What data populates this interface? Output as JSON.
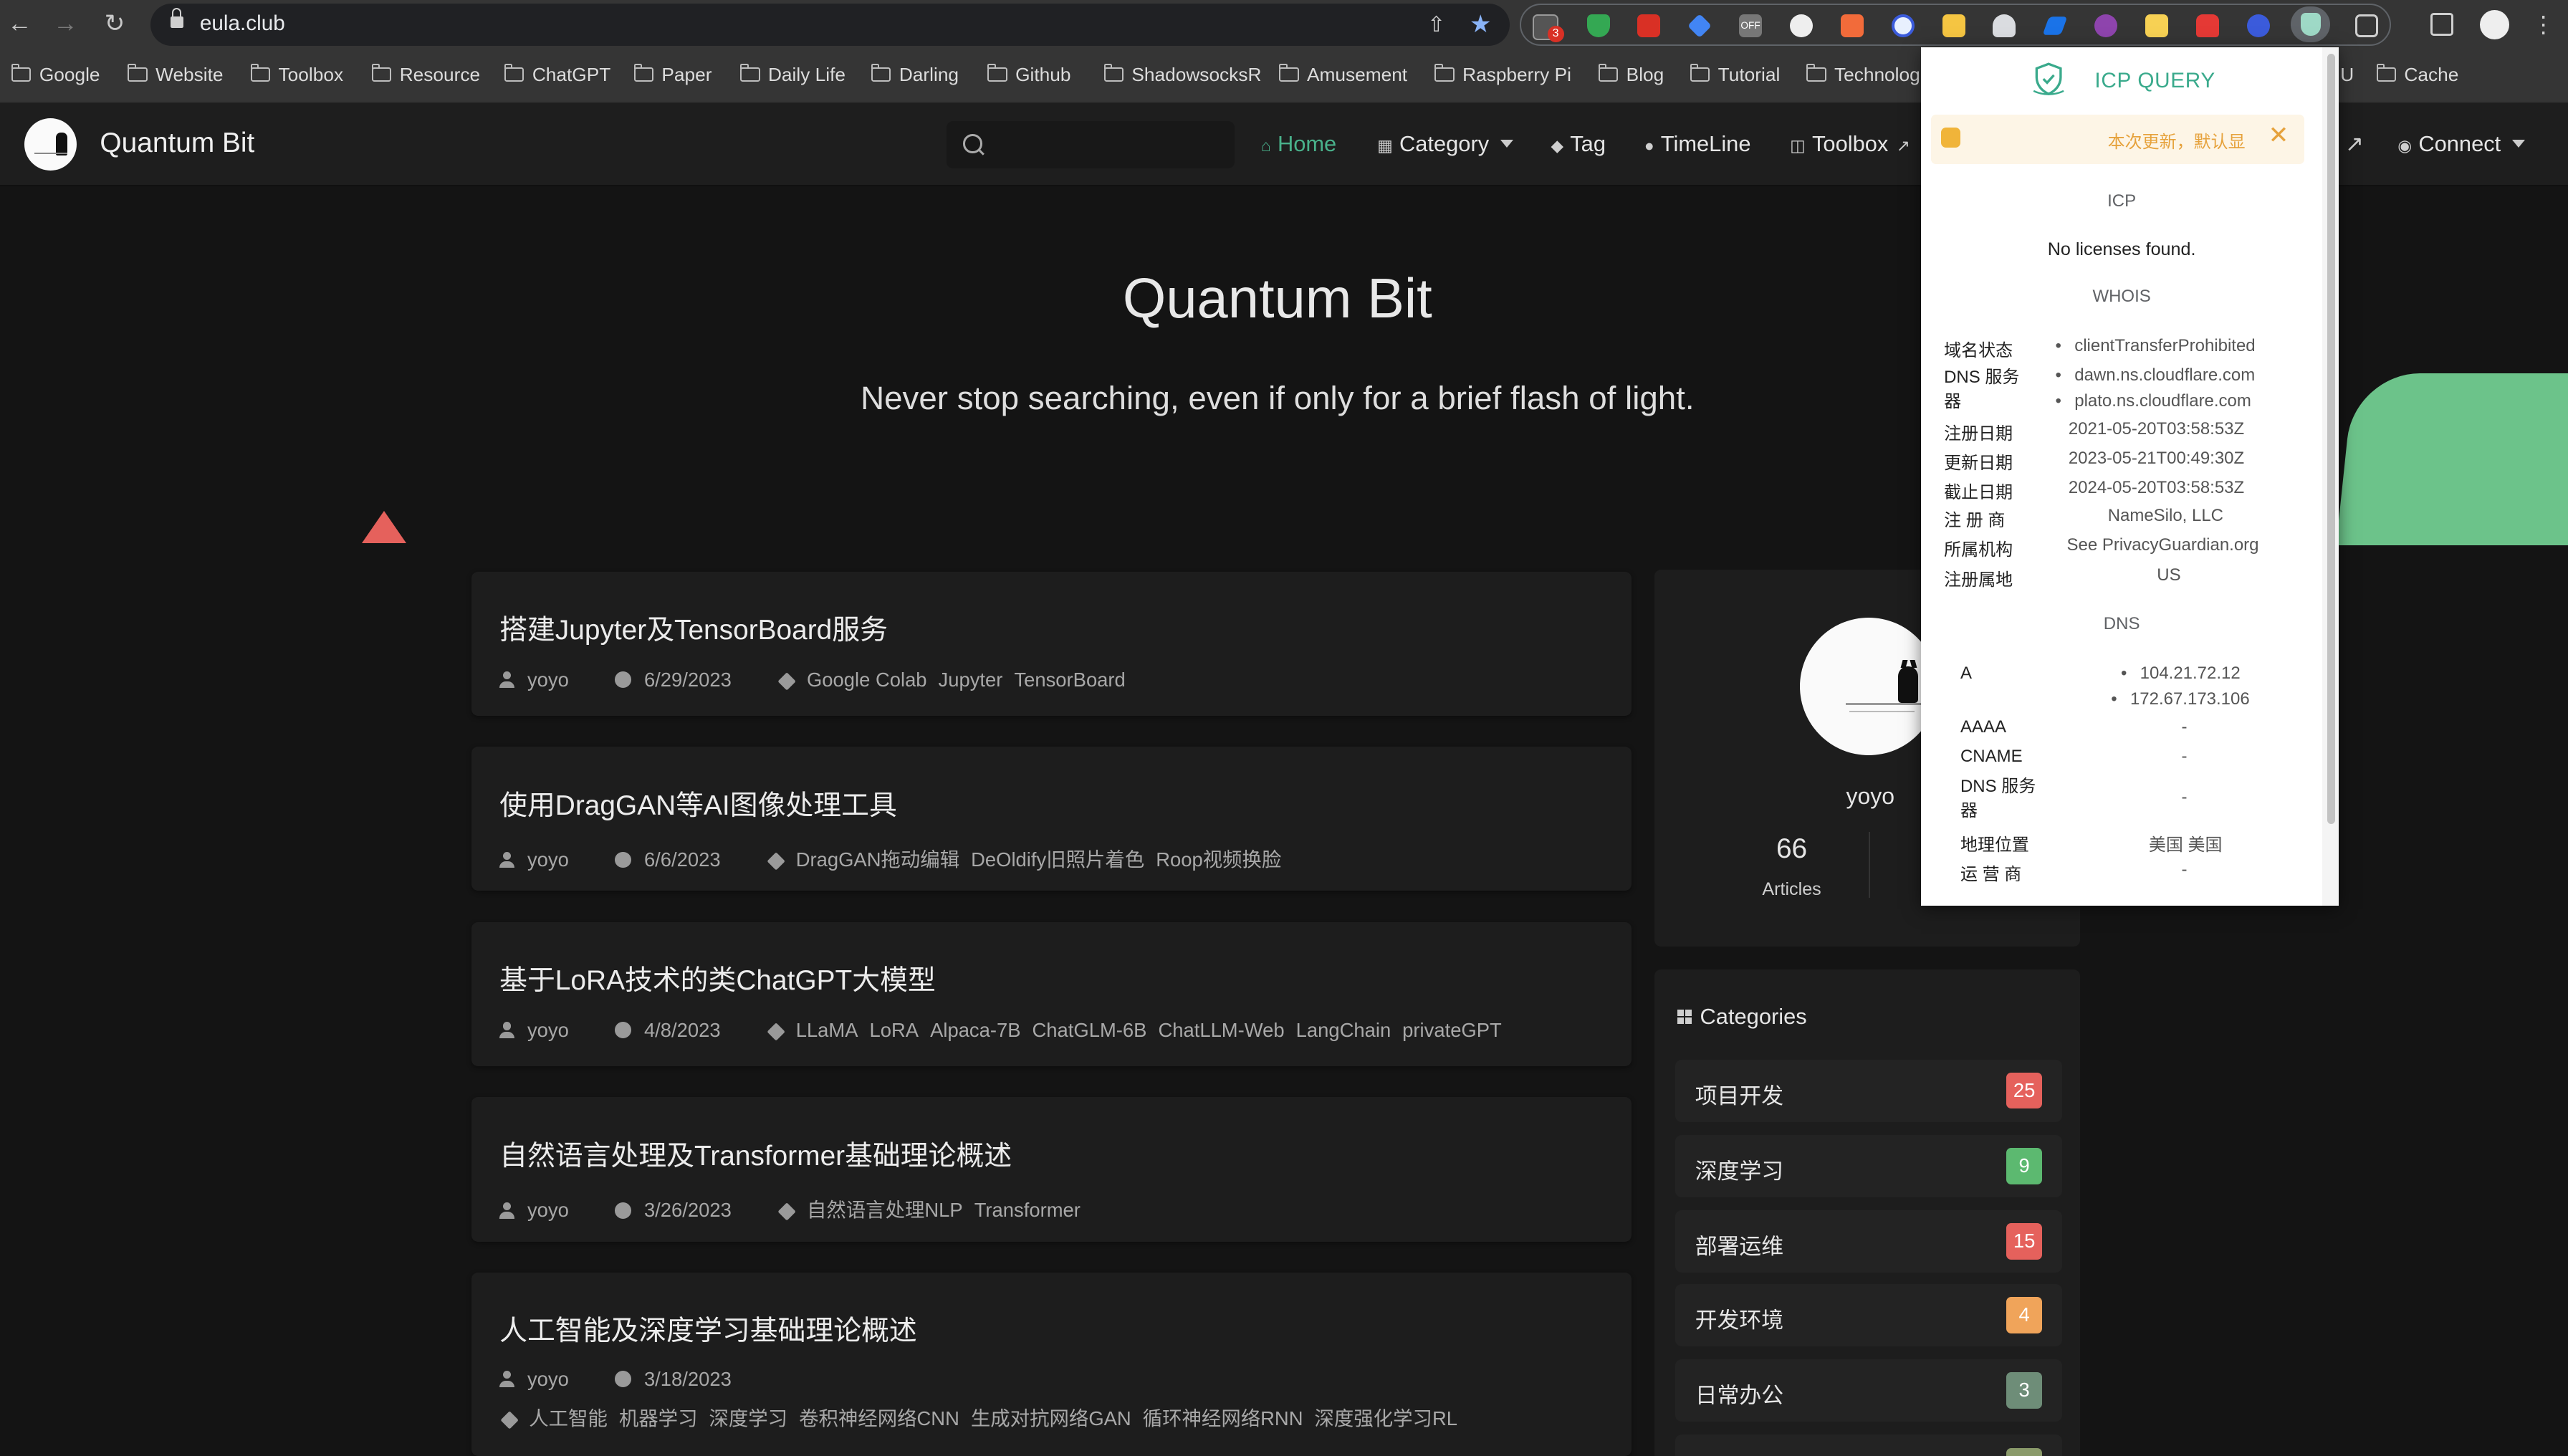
{
  "browser": {
    "url": "eula.club",
    "extension_badge": "3",
    "bookmarks": [
      "Google",
      "Website",
      "Toolbox",
      "Resource",
      "ChatGPT",
      "Paper",
      "Daily Life",
      "Darling",
      "Github",
      "ShadowsocksR",
      "Amusement",
      "Raspberry Pi",
      "Blog",
      "Tutorial",
      "Technolog",
      "U",
      "Cache"
    ]
  },
  "site": {
    "name": "Quantum Bit",
    "search_placeholder": "",
    "nav": {
      "home": "Home",
      "category": "Category",
      "tag": "Tag",
      "timeline": "TimeLine",
      "toolbox": "Toolbox",
      "connect": "Connect"
    },
    "hero_title": "Quantum Bit",
    "hero_subtitle": "Never stop searching, even if only for a brief flash of light."
  },
  "posts": [
    {
      "title": "搭建Jupyter及TensorBoard服务",
      "author": "yoyo",
      "date": "6/29/2023",
      "tags": [
        "Google Colab",
        "Jupyter",
        "TensorBoard"
      ]
    },
    {
      "title": "使用DragGAN等AI图像处理工具",
      "author": "yoyo",
      "date": "6/6/2023",
      "tags": [
        "DragGAN拖动编辑",
        "DeOldify旧照片着色",
        "Roop视频换脸"
      ]
    },
    {
      "title": "基于LoRA技术的类ChatGPT大模型",
      "author": "yoyo",
      "date": "4/8/2023",
      "tags": [
        "LLaMA",
        "LoRA",
        "Alpaca-7B",
        "ChatGLM-6B",
        "ChatLLM-Web",
        "LangChain",
        "privateGPT"
      ]
    },
    {
      "title": "自然语言处理及Transformer基础理论概述",
      "author": "yoyo",
      "date": "3/26/2023",
      "tags": [
        "自然语言处理NLP",
        "Transformer"
      ]
    },
    {
      "title": "人工智能及深度学习基础理论概述",
      "author": "yoyo",
      "date": "3/18/2023",
      "tags": [
        "人工智能",
        "机器学习",
        "深度学习",
        "卷积神经网络CNN",
        "生成对抗网络GAN",
        "循环神经网络RNN",
        "深度强化学习RL"
      ]
    }
  ],
  "profile": {
    "name": "yoyo",
    "articles_count": "66",
    "articles_label": "Articles"
  },
  "categories": {
    "heading": "Categories",
    "items": [
      {
        "label": "项目开发",
        "count": "25",
        "color": "#e5615c"
      },
      {
        "label": "深度学习",
        "count": "9",
        "color": "#5cb970"
      },
      {
        "label": "部署运维",
        "count": "15",
        "color": "#e5615c"
      },
      {
        "label": "开发环境",
        "count": "4",
        "color": "#f0a45a"
      },
      {
        "label": "日常办公",
        "count": "3",
        "color": "#6e8d78"
      }
    ]
  },
  "icp_popup": {
    "title": "ICP QUERY",
    "notice": "本次更新，默认显",
    "icp_heading": "ICP",
    "icp_result": "No licenses found.",
    "whois_heading": "WHOIS",
    "whois": {
      "status_k": "域名状态",
      "status_v": "clientTransferProhibited",
      "dns_k": "DNS 服务器",
      "dns_v1": "dawn.ns.cloudflare.com",
      "dns_v2": "plato.ns.cloudflare.com",
      "reg_k": "注册日期",
      "reg_v": "2021-05-20T03:58:53Z",
      "upd_k": "更新日期",
      "upd_v": "2023-05-21T00:49:30Z",
      "exp_k": "截止日期",
      "exp_v": "2024-05-20T03:58:53Z",
      "registrar_k": "注 册 商",
      "registrar_v": "NameSilo, LLC",
      "org_k": "所属机构",
      "org_v": "See PrivacyGuardian.org",
      "country_k": "注册属地",
      "country_v": "US"
    },
    "dns_heading": "DNS",
    "dns": {
      "a_k": "A",
      "a_v1": "104.21.72.12",
      "a_v2": "172.67.173.106",
      "aaaa_k": "AAAA",
      "aaaa_v": "-",
      "cname_k": "CNAME",
      "cname_v": "-",
      "ns_k": "DNS 服务器",
      "ns_v": "-",
      "geo_k": "地理位置",
      "geo_v": "美国 美国",
      "isp_k": "运 营 商",
      "isp_v": "-"
    }
  },
  "colors": {
    "accent_green": "#49b18b",
    "popup_accent": "#3aaa8c",
    "triangle": "#e5615c",
    "green_shape": "#6cc38a"
  }
}
